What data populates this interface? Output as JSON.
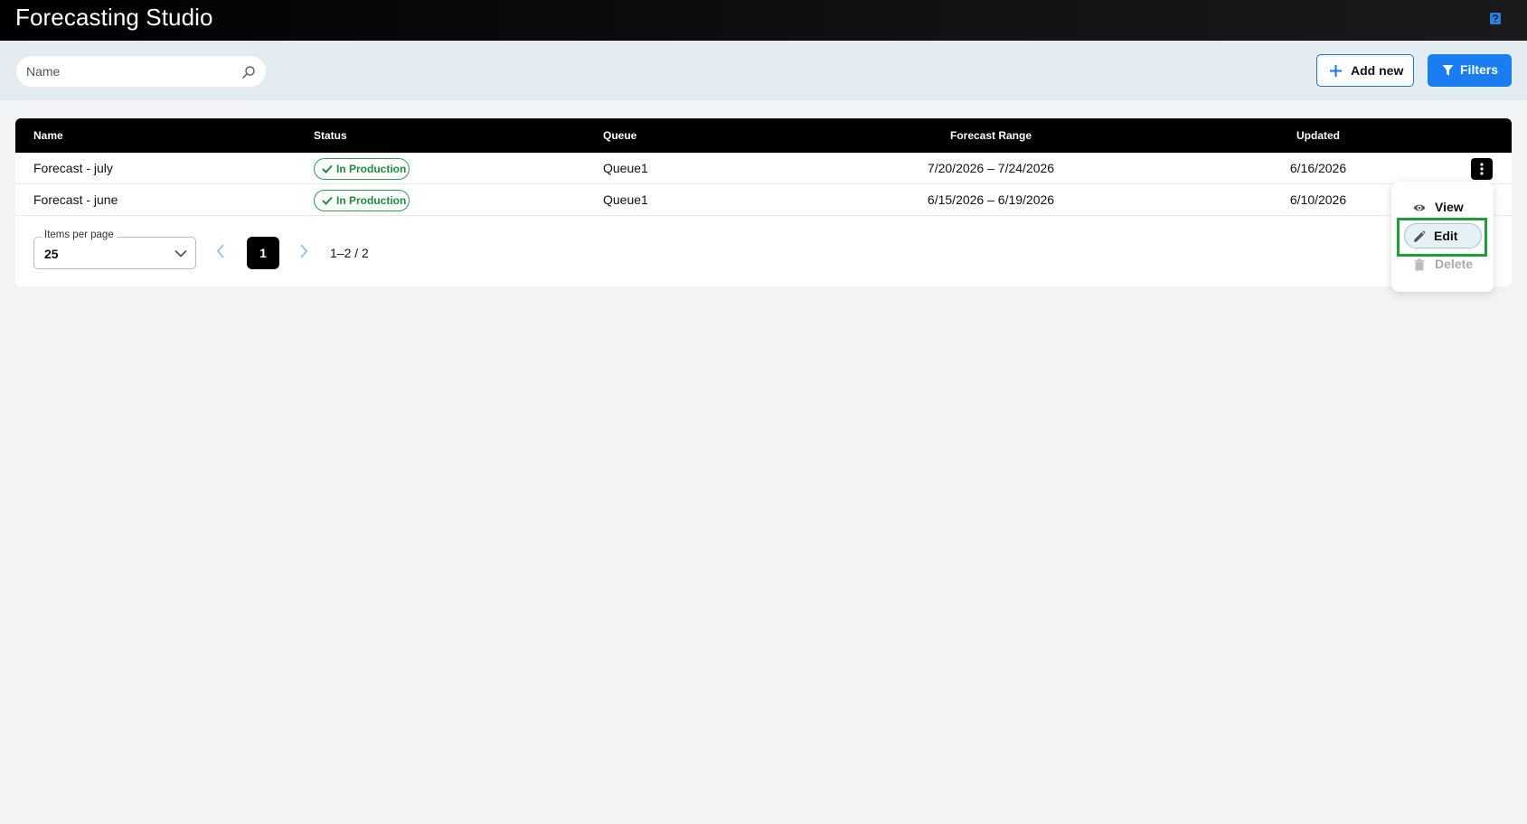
{
  "app": {
    "title": "Forecasting Studio"
  },
  "toolbar": {
    "search_placeholder": "Name",
    "add_label": "Add new",
    "filters_label": "Filters"
  },
  "table": {
    "columns": {
      "name": "Name",
      "status": "Status",
      "queue": "Queue",
      "range": "Forecast Range",
      "updated": "Updated"
    },
    "rows": [
      {
        "name": "Forecast - july",
        "status": "In Production",
        "queue": "Queue1",
        "range": "7/20/2026 – 7/24/2026",
        "updated": "6/16/2026"
      },
      {
        "name": "Forecast - june",
        "status": "In Production",
        "queue": "Queue1",
        "range": "6/15/2026 – 6/19/2026",
        "updated": "6/10/2026"
      }
    ]
  },
  "pagination": {
    "items_per_page_label": "Items per page",
    "items_per_page_value": "25",
    "current_page": "1",
    "range_text": "1–2 / 2"
  },
  "row_menu": {
    "view_label": "View",
    "edit_label": "Edit",
    "delete_label": "Delete"
  },
  "colors": {
    "accent": "#1a7ef2",
    "status_green": "#2e9e4f",
    "header_bg": "#000000",
    "highlight_outline": "#1f9d3a"
  }
}
